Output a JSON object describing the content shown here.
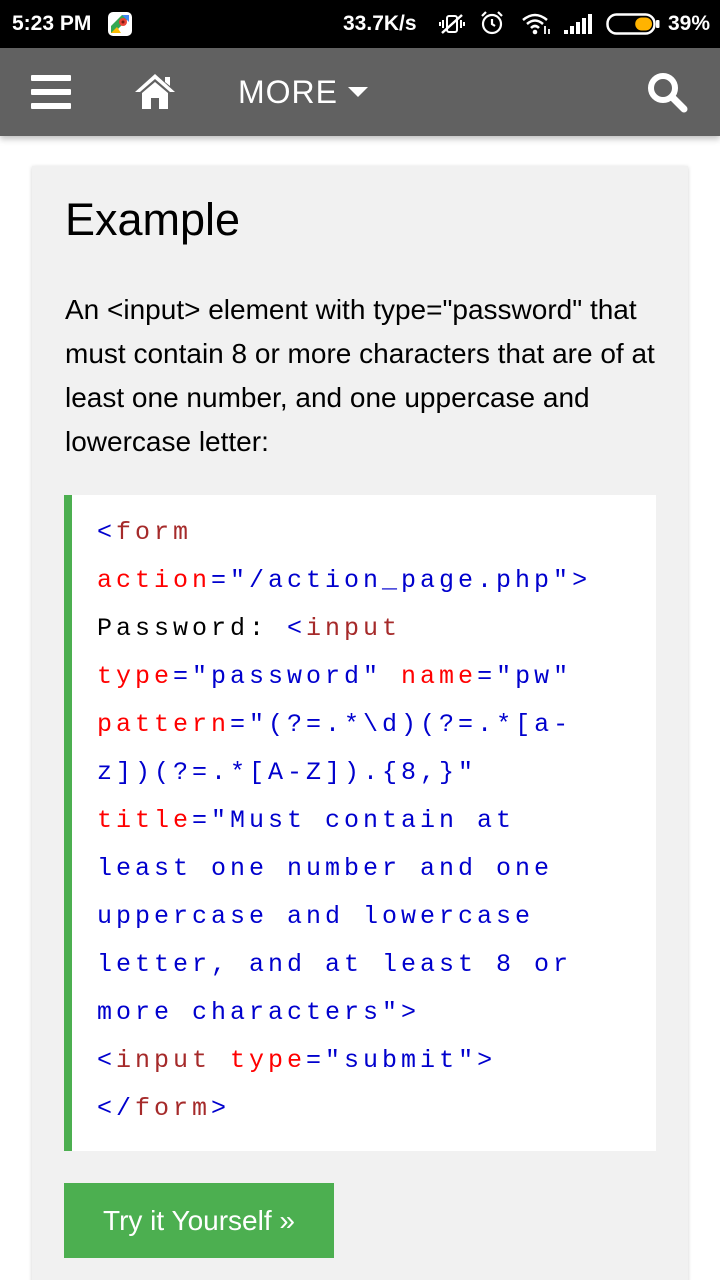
{
  "status_bar": {
    "time": "5:23 PM",
    "network_speed": "33.7K/s",
    "battery_percent": "39%",
    "battery_level": 0.39,
    "icons": [
      "maps-icon",
      "vibrate-mute-icon",
      "alarm-icon",
      "wifi-icon",
      "signal-icon",
      "battery-icon"
    ]
  },
  "navbar": {
    "more_label": "MORE",
    "icons": [
      "menu-icon",
      "home-icon",
      "caret-down-icon",
      "search-icon"
    ],
    "background": "#616161"
  },
  "example": {
    "title": "Example",
    "description": "An <input> element with type=\"password\" that must contain 8 or more characters that are of at least one number, and one uppercase and lowercase letter:",
    "code_lines": [
      [
        {
          "t": "<",
          "c": "ang"
        },
        {
          "t": "form",
          "c": "tag"
        }
      ],
      [
        {
          "t": "action",
          "c": "attr"
        },
        {
          "t": "=\"/action_page.php\"",
          "c": "val"
        },
        {
          "t": ">",
          "c": "ang"
        }
      ],
      [
        {
          "t": "Password: ",
          "c": "txt"
        },
        {
          "t": "<",
          "c": "ang"
        },
        {
          "t": "input",
          "c": "tag"
        }
      ],
      [
        {
          "t": "type",
          "c": "attr"
        },
        {
          "t": "=\"password\" ",
          "c": "val"
        },
        {
          "t": "name",
          "c": "attr"
        },
        {
          "t": "=\"pw\"",
          "c": "val"
        }
      ],
      [
        {
          "t": "pattern",
          "c": "attr"
        },
        {
          "t": "=\"(?=.*\\d)(?=.*[a-",
          "c": "val"
        }
      ],
      [
        {
          "t": "z])(?=.*[A-Z]).{8,}\"",
          "c": "val"
        }
      ],
      [
        {
          "t": "title",
          "c": "attr"
        },
        {
          "t": "=\"Must contain at",
          "c": "val"
        }
      ],
      [
        {
          "t": "least one number and one",
          "c": "val"
        }
      ],
      [
        {
          "t": "uppercase and lowercase",
          "c": "val"
        }
      ],
      [
        {
          "t": "letter, and at least 8 or",
          "c": "val"
        }
      ],
      [
        {
          "t": "more characters\"",
          "c": "val"
        },
        {
          "t": ">",
          "c": "ang"
        }
      ],
      [
        {
          "t": "<",
          "c": "ang"
        },
        {
          "t": "input ",
          "c": "tag"
        },
        {
          "t": "type",
          "c": "attr"
        },
        {
          "t": "=\"submit\"",
          "c": "val"
        },
        {
          "t": ">",
          "c": "ang"
        }
      ],
      [
        {
          "t": "</",
          "c": "ang"
        },
        {
          "t": "form",
          "c": "tag"
        },
        {
          "t": ">",
          "c": "ang"
        }
      ]
    ],
    "try_button_label": "Try it Yourself »",
    "accent": "#4caf50"
  }
}
